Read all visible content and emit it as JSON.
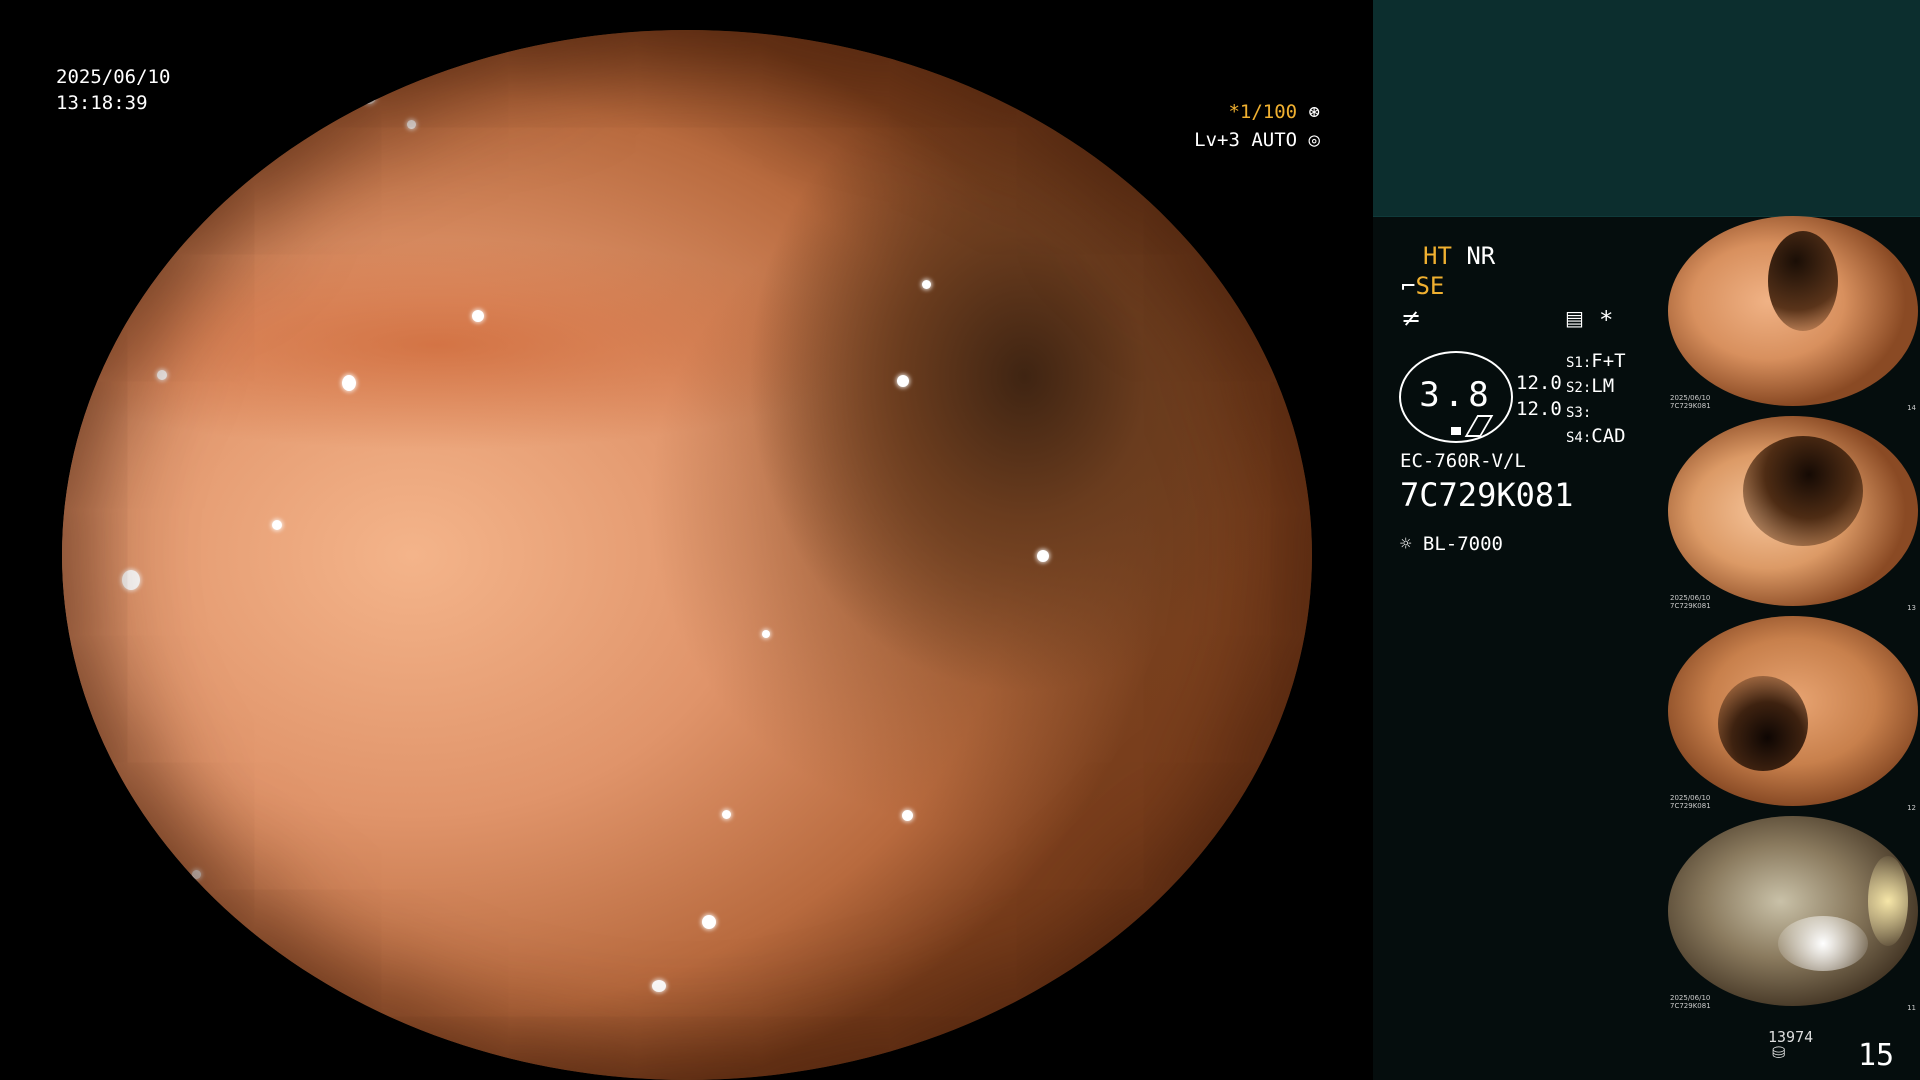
{
  "main": {
    "date": "2025/06/10",
    "time": "13:18:39",
    "enhancement": "*1/100",
    "level": "Lv+3 AUTO"
  },
  "panel": {
    "ht": "HT",
    "nr": "NR",
    "se": "SE",
    "asterisk": "*",
    "gauge_value": "3.8",
    "val1": "12.0",
    "val2": "12.0",
    "s1_label": "S1:",
    "s1_value": "F+T",
    "s2_label": "S2:",
    "s2_value": "LM",
    "s3_label": "S3:",
    "s3_value": "",
    "s4_label": "S4:",
    "s4_value": "CAD",
    "scope_model": "EC-760R-V/L",
    "serial": "7C729K081",
    "light_source": "BL-7000"
  },
  "thumbnails": [
    {
      "tag_date": "2025/06/10",
      "tag_id": "7C729K081",
      "num": "14"
    },
    {
      "tag_date": "2025/06/10",
      "tag_id": "7C729K081",
      "num": "13"
    },
    {
      "tag_date": "2025/06/10",
      "tag_id": "7C729K081",
      "num": "12"
    },
    {
      "tag_date": "2025/06/10",
      "tag_id": "7C729K081",
      "num": "11"
    }
  ],
  "footer": {
    "image_count": "13974",
    "page": "15"
  },
  "colors": {
    "accent": "#f0b030",
    "panel_bg": "#050d0d",
    "top_box": "#0c2e2e"
  }
}
